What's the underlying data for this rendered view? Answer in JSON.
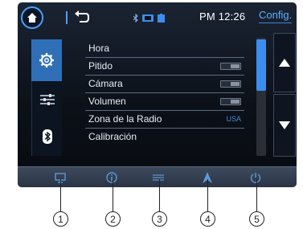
{
  "status": {
    "time": "PM 12:26",
    "tab_label": "Config."
  },
  "icons": {
    "home": "home-icon",
    "back": "back-icon",
    "bluetooth_status": "bluetooth-icon",
    "phone_status": "phone-icon",
    "battery_status": "battery-icon",
    "settings_tab": "gear-icon",
    "sound_tab": "equalizer-icon",
    "bluetooth_tab": "bluetooth-icon"
  },
  "menu": {
    "items": [
      {
        "label": "Hora"
      },
      {
        "label": "Pitido",
        "toggle": "off"
      },
      {
        "label": "Cámara",
        "toggle": "off"
      },
      {
        "label": "Volumen",
        "toggle": "off"
      },
      {
        "label": "Zona de la Radio",
        "value": "USA"
      },
      {
        "label": "Calibración"
      }
    ]
  },
  "bottom_bar": {
    "icons": [
      "screen-icon",
      "info-icon",
      "equalizer-icon",
      "navigation-icon",
      "power-icon"
    ]
  },
  "callouts": [
    "1",
    "2",
    "3",
    "4",
    "5"
  ],
  "colors": {
    "accent": "#3b8ef0",
    "active_tab": "#2f6fb8",
    "text": "#e8eef6"
  }
}
